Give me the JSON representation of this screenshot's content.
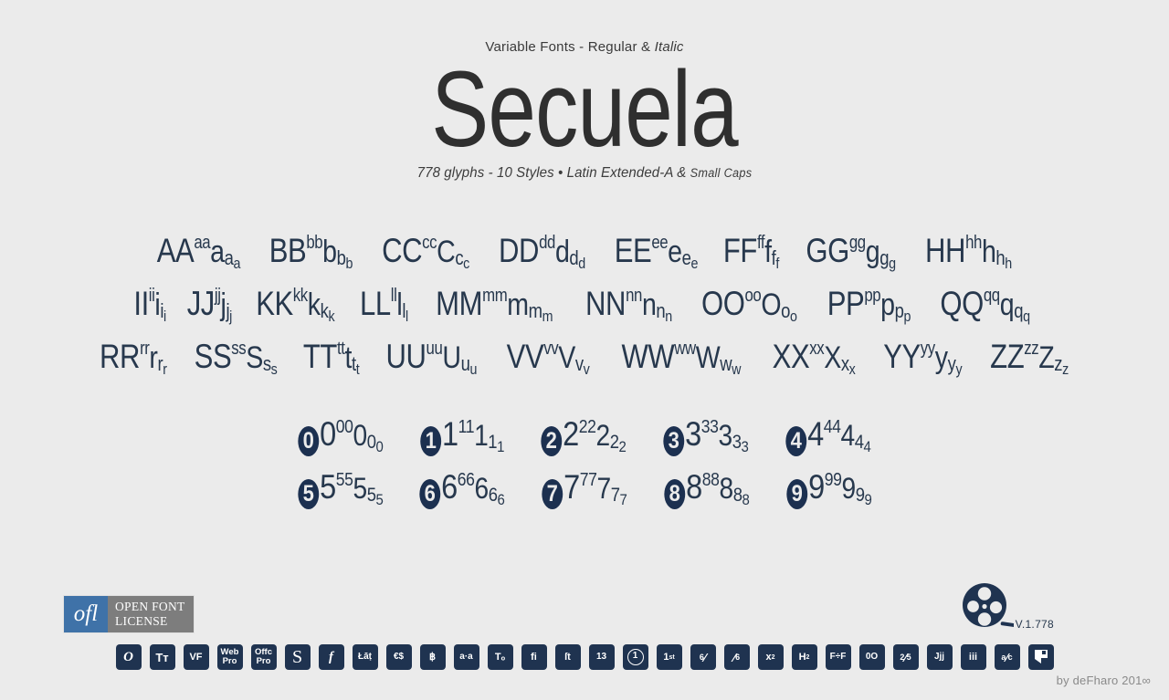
{
  "colors": {
    "background": "#ebebeb",
    "glyph": "#27384d",
    "tile_bg": "#1f3350",
    "ofl_blue": "#3f72a8",
    "ofl_gray": "#7d7d7d",
    "wordmark": "#2f2f2f"
  },
  "header": {
    "eyebrow_prefix": "Variable Fonts - Regular & ",
    "eyebrow_italic": "Italic",
    "title": "Secuela",
    "subline_main": "778 glyphs - 10 Styles • Latin Extended-A & ",
    "subline_smallcaps": "Small Caps"
  },
  "alphabet": {
    "rows": [
      [
        {
          "cap": "AA",
          "sup": "aa",
          "mid": "a",
          "sub1": "a",
          "sub2": "a"
        },
        {
          "cap": "BB",
          "sup": "bb",
          "mid": "b",
          "sub1": "b",
          "sub2": "b"
        },
        {
          "cap": "CC",
          "sup": "cc",
          "mid": "C",
          "sub1": "c",
          "sub2": "c"
        },
        {
          "cap": "DD",
          "sup": "dd",
          "mid": "d",
          "sub1": "d",
          "sub2": "d"
        },
        {
          "cap": "EE",
          "sup": "ee",
          "mid": "e",
          "sub1": "e",
          "sub2": "e"
        },
        {
          "cap": "FF",
          "sup": "ff",
          "mid": "f",
          "sub1": "f",
          "sub2": "f"
        },
        {
          "cap": "GG",
          "sup": "gg",
          "mid": "g",
          "sub1": "g",
          "sub2": "g"
        },
        {
          "cap": "HH",
          "sup": "hh",
          "mid": "h",
          "sub1": "h",
          "sub2": "h"
        }
      ],
      [
        {
          "cap": "II",
          "sup": "ii",
          "mid": "i",
          "sub1": "i",
          "sub2": "i"
        },
        {
          "cap": "JJ",
          "sup": "jj",
          "mid": "j",
          "sub1": "j",
          "sub2": "j"
        },
        {
          "cap": "KK",
          "sup": "kk",
          "mid": "k",
          "sub1": "k",
          "sub2": "k"
        },
        {
          "cap": "LL",
          "sup": "ll",
          "mid": "l",
          "sub1": "l",
          "sub2": "l"
        },
        {
          "cap": "MM",
          "sup": "mm",
          "mid": "m",
          "sub1": "m",
          "sub2": "m"
        },
        {
          "cap": "NN",
          "sup": "nn",
          "mid": "n",
          "sub1": "n",
          "sub2": "n"
        },
        {
          "cap": "OO",
          "sup": "oo",
          "mid": "O",
          "sub1": "o",
          "sub2": "o"
        },
        {
          "cap": "PP",
          "sup": "pp",
          "mid": "p",
          "sub1": "p",
          "sub2": "p"
        },
        {
          "cap": "QQ",
          "sup": "qq",
          "mid": "q",
          "sub1": "q",
          "sub2": "q"
        }
      ],
      [
        {
          "cap": "RR",
          "sup": "rr",
          "mid": "r",
          "sub1": "r",
          "sub2": "r"
        },
        {
          "cap": "SS",
          "sup": "ss",
          "mid": "S",
          "sub1": "s",
          "sub2": "s"
        },
        {
          "cap": "TT",
          "sup": "tt",
          "mid": "t",
          "sub1": "t",
          "sub2": "t"
        },
        {
          "cap": "UU",
          "sup": "uu",
          "mid": "U",
          "sub1": "u",
          "sub2": "u"
        },
        {
          "cap": "VV",
          "sup": "vv",
          "mid": "V",
          "sub1": "v",
          "sub2": "v"
        },
        {
          "cap": "WW",
          "sup": "ww",
          "mid": "W",
          "sub1": "w",
          "sub2": "w"
        },
        {
          "cap": "XX",
          "sup": "xx",
          "mid": "X",
          "sub1": "x",
          "sub2": "x"
        },
        {
          "cap": "YY",
          "sup": "yy",
          "mid": "y",
          "sub1": "y",
          "sub2": "y"
        },
        {
          "cap": "ZZ",
          "sup": "zz",
          "mid": "Z",
          "sub1": "z",
          "sub2": "z"
        }
      ]
    ]
  },
  "numerals": {
    "rows": [
      [
        {
          "neg": "0",
          "big": "0",
          "sup": "00",
          "mid": "0",
          "sub1": "0",
          "sub2": "0"
        },
        {
          "neg": "1",
          "big": "1",
          "sup": "11",
          "mid": "1",
          "sub1": "1",
          "sub2": "1"
        },
        {
          "neg": "2",
          "big": "2",
          "sup": "22",
          "mid": "2",
          "sub1": "2",
          "sub2": "2"
        },
        {
          "neg": "3",
          "big": "3",
          "sup": "33",
          "mid": "3",
          "sub1": "3",
          "sub2": "3"
        },
        {
          "neg": "4",
          "big": "4",
          "sup": "44",
          "mid": "4",
          "sub1": "4",
          "sub2": "4"
        }
      ],
      [
        {
          "neg": "5",
          "big": "5",
          "sup": "55",
          "mid": "5",
          "sub1": "5",
          "sub2": "5"
        },
        {
          "neg": "6",
          "big": "6",
          "sup": "66",
          "mid": "6",
          "sub1": "6",
          "sub2": "6"
        },
        {
          "neg": "7",
          "big": "7",
          "sup": "77",
          "mid": "7",
          "sub1": "7",
          "sub2": "7"
        },
        {
          "neg": "8",
          "big": "8",
          "sup": "88",
          "mid": "8",
          "sub1": "8",
          "sub2": "8"
        },
        {
          "neg": "9",
          "big": "9",
          "sup": "99",
          "mid": "9",
          "sub1": "9",
          "sub2": "9"
        }
      ]
    ]
  },
  "ofl": {
    "mark": "ofl",
    "line1": "OPEN FONT",
    "line2": "LICENSE"
  },
  "reel": {
    "icon": "film-reel-icon",
    "version": "V.1.778"
  },
  "features": [
    {
      "name": "opentype",
      "label": "O",
      "style": "ital"
    },
    {
      "name": "truetype",
      "label": "Tᴛ",
      "style": "plain"
    },
    {
      "name": "variable-font",
      "label": "VF",
      "style": "sm"
    },
    {
      "name": "web-pro",
      "l1": "Web",
      "l2": "Pro",
      "style": "two"
    },
    {
      "name": "office-pro",
      "l1": "Offc",
      "l2": "Pro",
      "style": "two"
    },
    {
      "name": "swash",
      "label": "S",
      "style": "serif-s"
    },
    {
      "name": "italic-f",
      "label": "f",
      "style": "ital"
    },
    {
      "name": "latin-extended",
      "label": "Łāṭ",
      "style": "xs"
    },
    {
      "name": "currency",
      "label": "€$",
      "style": "xs"
    },
    {
      "name": "bitcoin",
      "label": "฿",
      "style": "sm"
    },
    {
      "name": "kerning",
      "label": "a·a",
      "style": "xs"
    },
    {
      "name": "tracking",
      "label": "Tₒ",
      "style": "sm"
    },
    {
      "name": "ligature-fi",
      "label": "fi",
      "style": "sm"
    },
    {
      "name": "ligature-st",
      "label": "ſt",
      "style": "sm"
    },
    {
      "name": "oldstyle-figures",
      "label": "13",
      "style": "xs"
    },
    {
      "name": "circled-numbers",
      "label": "1",
      "style": "circ"
    },
    {
      "name": "ordinals",
      "label": "1",
      "sup": "st",
      "style": "sup"
    },
    {
      "name": "numerator",
      "num": "6",
      "slash": "/",
      "style": "num-slash"
    },
    {
      "name": "denominator",
      "slash": "/",
      "den": "6",
      "style": "slash-den"
    },
    {
      "name": "superscript",
      "label": "x",
      "sup": "2",
      "style": "sup"
    },
    {
      "name": "subscript",
      "label": "H",
      "sub": "2",
      "style": "sub"
    },
    {
      "name": "contextual-alt",
      "label": "F÷F",
      "style": "xs"
    },
    {
      "name": "slashed-zero",
      "label": "0O",
      "style": "xs"
    },
    {
      "name": "fractions",
      "num": "2",
      "den": "5",
      "style": "frac"
    },
    {
      "name": "alternates-j",
      "label": "Jjj",
      "style": "xs"
    },
    {
      "name": "dotted-i",
      "label": "iii",
      "style": "sm"
    },
    {
      "name": "percent-alt",
      "num": "a",
      "den": "c",
      "style": "frac"
    },
    {
      "name": "defharo-logo",
      "label": "",
      "style": "flag"
    }
  ],
  "signature": {
    "text": "by deFharo  201∞"
  }
}
